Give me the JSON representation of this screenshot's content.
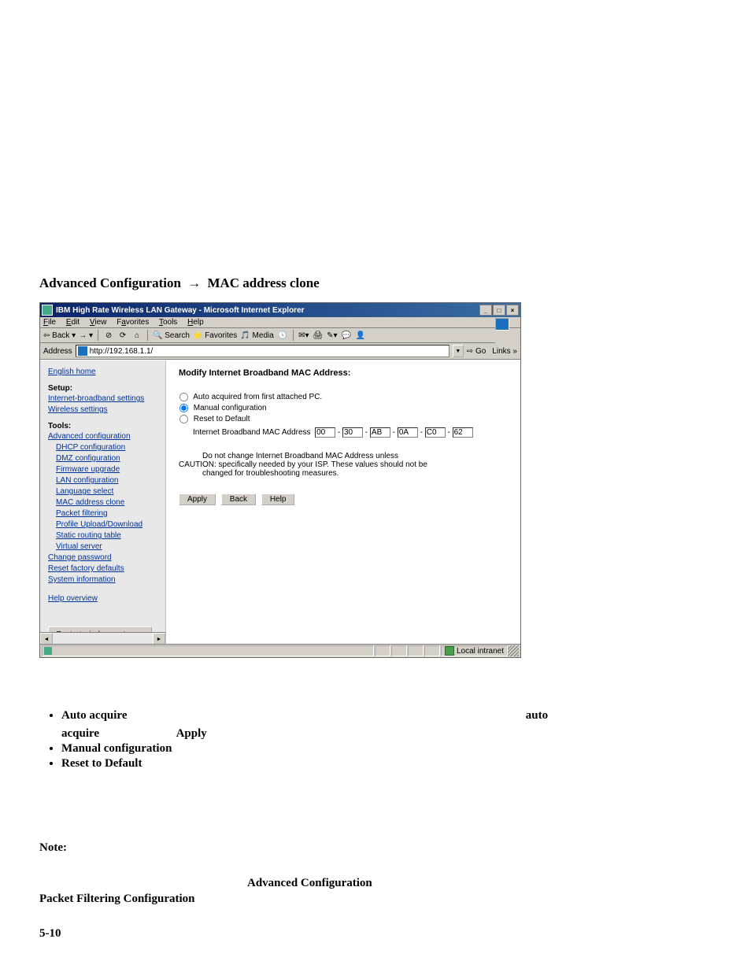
{
  "section": {
    "prefix": "Advanced Configuration",
    "arrow": "→",
    "suffix": "MAC address clone"
  },
  "ie": {
    "title": "IBM High Rate Wireless LAN Gateway - Microsoft Internet Explorer",
    "win_min": "_",
    "win_max": "□",
    "win_close": "×",
    "menu": {
      "file": "File",
      "edit": "Edit",
      "view": "View",
      "favorites": "Favorites",
      "tools": "Tools",
      "help": "Help"
    },
    "toolbar": {
      "back": "Back",
      "fwd": "",
      "stop": "",
      "refresh": "",
      "home": "",
      "search": "Search",
      "favorites": "Favorites",
      "media": "Media",
      "history": "",
      "mail": "",
      "print": "",
      "edit": "",
      "discuss": ""
    },
    "address": {
      "label": "Address",
      "value": "http://192.168.1.1/",
      "go": "Go",
      "links": "Links"
    },
    "status": {
      "left": "",
      "zone": "Local intranet"
    }
  },
  "sidebar": {
    "english_home": "English home",
    "setup_hdr": "Setup:",
    "ibs": "Internet-broadband settings",
    "ws": "Wireless settings",
    "tools_hdr": "Tools:",
    "adv": "Advanced configuration",
    "dhcp": "DHCP configuration",
    "dmz": "DMZ configuration",
    "fw": "Firmware upgrade",
    "lan": "LAN configuration",
    "lang": "Language select",
    "mac": "MAC address clone",
    "pf": "Packet filtering",
    "pud": "Profile Upload/Download",
    "srt": "Static routing table",
    "vs": "Virtual server",
    "cp": "Change password",
    "rfd": "Reset factory defaults",
    "si": "System information",
    "ho": "Help overview",
    "restart": "Restart wireless gateway",
    "sb_left": "◄",
    "sb_right": "►"
  },
  "main": {
    "title": "Modify Internet Broadband MAC Address:",
    "r1": "Auto acquired from first attached PC.",
    "r2": "Manual configuration",
    "r3": "Reset to Default",
    "mac_label": "Internet Broadband MAC Address",
    "mac": [
      "00",
      "30",
      "AB",
      "0A",
      "C0",
      "62"
    ],
    "hyphen": "-",
    "caution1": "Do not change Internet Broadband MAC Address unless",
    "caution2": "CAUTION: specifically needed by your ISP. These values should not be",
    "caution3": "changed for troubleshooting measures.",
    "btn_apply": "Apply",
    "btn_back": "Back",
    "btn_help": "Help"
  },
  "body": {
    "auto_b": "Auto acquire",
    "auto_word": "auto",
    "acquire_b": "acquire",
    "apply_b": "Apply",
    "manual_b": "Manual configuration",
    "reset_b": "Reset to Default",
    "note": "Note:",
    "adv_conf": "Advanced Configuration",
    "pfc": "Packet Filtering Configuration"
  },
  "pagenum": "5-10"
}
